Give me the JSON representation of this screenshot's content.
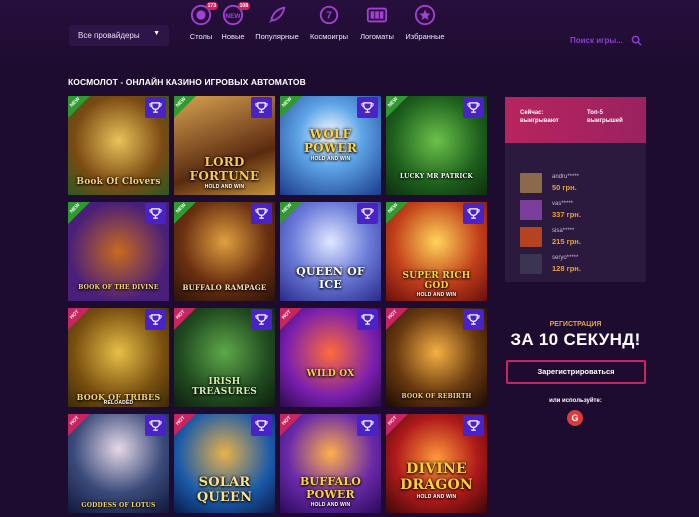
{
  "header": {
    "provider_select": "Все провайдеры",
    "categories": [
      {
        "label": "Столы",
        "icon": "table-chips-icon",
        "badge": "173"
      },
      {
        "label": "Новые",
        "icon": "new-badge-icon",
        "badge": "108"
      },
      {
        "label": "Популярные",
        "icon": "rocket-icon",
        "badge": ""
      },
      {
        "label": "Космоигры",
        "icon": "planet-seven-icon",
        "badge": ""
      },
      {
        "label": "Логоматы",
        "icon": "slot-machine-icon",
        "badge": ""
      },
      {
        "label": "Избранные",
        "icon": "star-icon",
        "badge": ""
      }
    ],
    "search_placeholder": "Поиск игры..."
  },
  "main": {
    "title": "КОСМОЛОТ - ОНЛАЙН КАЗИНО ИГРОВЫХ АВТОМАТОВ",
    "games": [
      {
        "name": "Book Of Clovers",
        "tag": "NEW"
      },
      {
        "name": "LORD FORTUNE",
        "sub": "HOLD AND WIN",
        "tag": "NEW"
      },
      {
        "name": "WOLF POWER",
        "sub": "HOLD AND WIN",
        "tag": "NEW"
      },
      {
        "name": "LUCKY MR PATRICK",
        "tag": "NEW"
      },
      {
        "name": "BOOK OF THE DIVINE",
        "tag": "NEW"
      },
      {
        "name": "BUFFALO RAMPAGE",
        "tag": "NEW"
      },
      {
        "name": "QUEEN OF ICE",
        "tag": "NEW"
      },
      {
        "name": "SUPER RICH GOD",
        "sub": "HOLD AND WIN",
        "tag": "NEW"
      },
      {
        "name": "BOOK OF TRIBES",
        "sub": "RELOADED",
        "tag": "HOT"
      },
      {
        "name": "IRISH TREASURES",
        "tag": "HOT"
      },
      {
        "name": "WILD OX",
        "tag": "HOT"
      },
      {
        "name": "BOOK OF REBIRTH",
        "tag": "HOT"
      },
      {
        "name": "GODDESS OF LOTUS",
        "tag": "HOT"
      },
      {
        "name": "SOLAR QUEEN",
        "tag": "HOT"
      },
      {
        "name": "BUFFALO POWER",
        "sub": "HOLD AND WIN",
        "tag": "HOT"
      },
      {
        "name": "DIVINE DRAGON",
        "sub": "HOLD AND WIN",
        "tag": "HOT"
      }
    ]
  },
  "winners": {
    "col1": [
      "Сейчас:",
      "выигрывают"
    ],
    "col2": [
      "Топ-5",
      "выигрышей"
    ],
    "rows": [
      {
        "user": "andru*****",
        "amount": "50 грн.",
        "color": "#8a6a4a"
      },
      {
        "user": "vas*****",
        "amount": "337 грн.",
        "color": "#7a3f9a"
      },
      {
        "user": "sisa*****",
        "amount": "215 грн.",
        "color": "#b3441f"
      },
      {
        "user": "seryo*****",
        "amount": "128 грн.",
        "color": "#3a3550"
      }
    ]
  },
  "registration": {
    "label": "РЕГИСТРАЦИЯ",
    "headline": "ЗА 10 СЕКУНД!",
    "button": "Зарегистрироваться",
    "or_use": "или используйте:",
    "google": "G"
  }
}
